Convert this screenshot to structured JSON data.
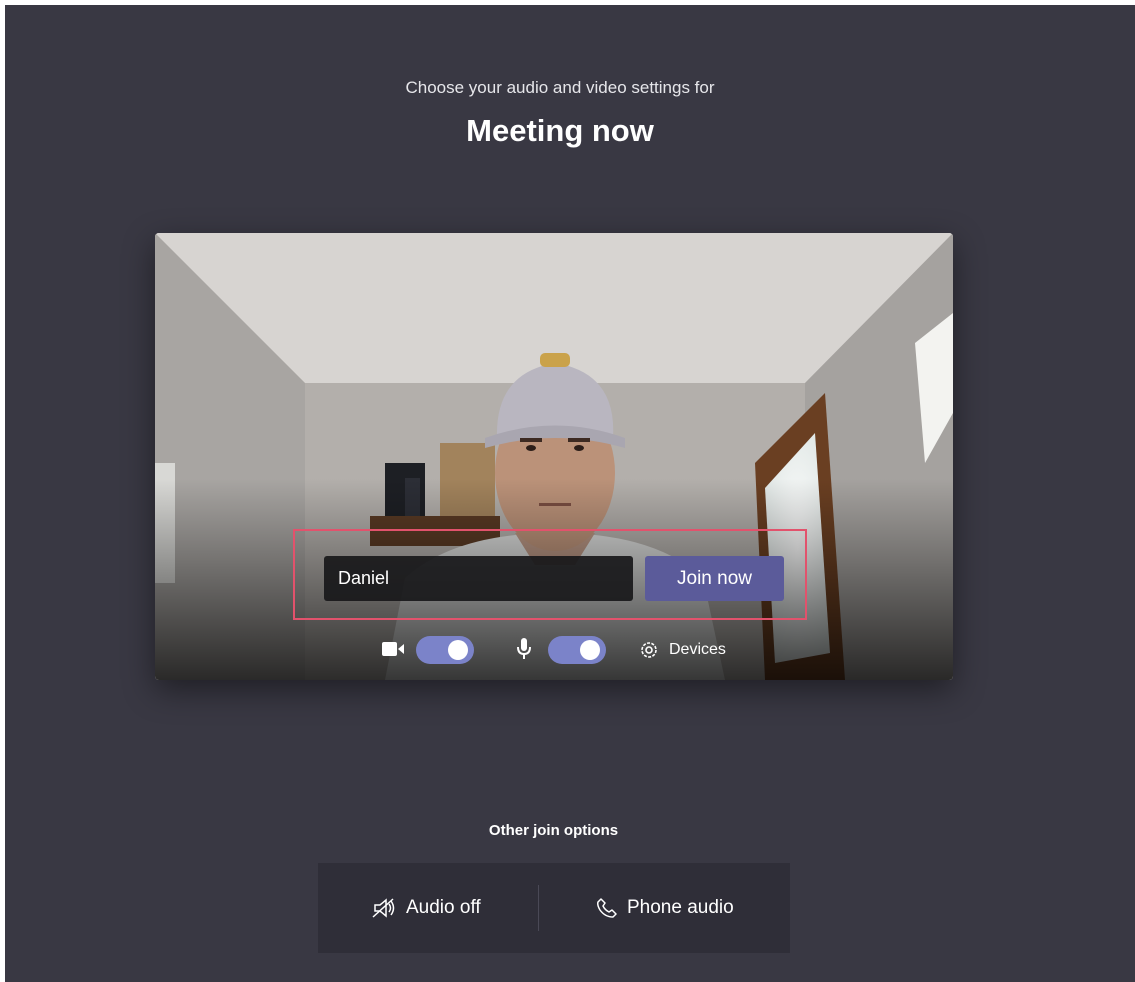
{
  "header": {
    "subtitle": "Choose your audio and video settings for",
    "title": "Meeting now"
  },
  "join": {
    "name_value": "Daniel",
    "join_label": "Join now"
  },
  "controls": {
    "camera_on": true,
    "mic_on": true,
    "devices_label": "Devices"
  },
  "other_options": {
    "label": "Other join options",
    "audio_off_label": "Audio off",
    "phone_audio_label": "Phone audio"
  },
  "colors": {
    "background": "#393843",
    "accent": "#5b5b9a",
    "toggle_on": "#7b83c9",
    "highlight": "#e2526c"
  },
  "icons": {
    "camera": "video-camera-icon",
    "microphone": "microphone-icon",
    "devices": "gear-icon",
    "audio_off": "speaker-muted-icon",
    "phone": "phone-icon"
  }
}
